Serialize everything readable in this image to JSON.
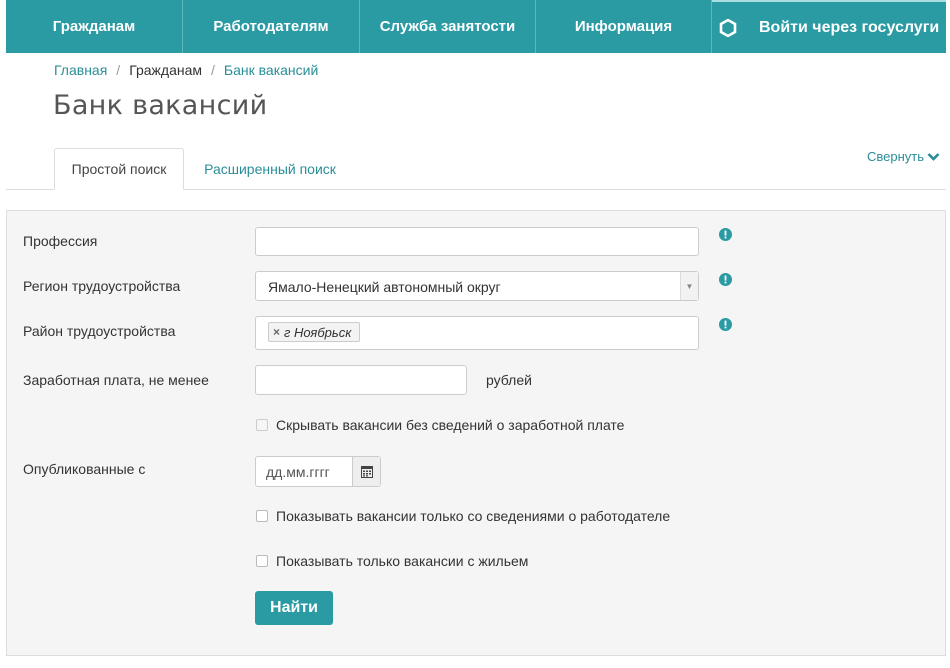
{
  "nav": {
    "items": [
      "Гражданам",
      "Работодателям",
      "Служба занятости",
      "Информация"
    ],
    "gosuslugi_label": "Войти через госуслуги"
  },
  "breadcrumb": {
    "home": "Главная",
    "section": "Гражданам",
    "current": "Банк вакансий"
  },
  "page_title": "Банк вакансий",
  "tabs": {
    "simple": "Простой поиск",
    "advanced": "Расширенный поиск",
    "collapse": "Свернуть"
  },
  "form": {
    "profession_label": "Профессия",
    "profession_value": "",
    "region_label": "Регион трудоустройства",
    "region_value": "Ямало-Ненецкий автономный округ",
    "district_label": "Район трудоустройства",
    "district_tag": "г Ноябрьск",
    "salary_label": "Заработная плата, не менее",
    "salary_value": "",
    "salary_suffix": "рублей",
    "hide_no_salary": "Скрывать вакансии без сведений о заработной плате",
    "published_label": "Опубликованные с",
    "date_placeholder": "дд.мм.гггг",
    "employer_info_only": "Показывать вакансии только со сведениями о работодателе",
    "housing_only": "Показывать только вакансии с жильем",
    "search_button": "Найти"
  },
  "colors": {
    "accent": "#2a9aa3",
    "link": "#2a8e98"
  }
}
